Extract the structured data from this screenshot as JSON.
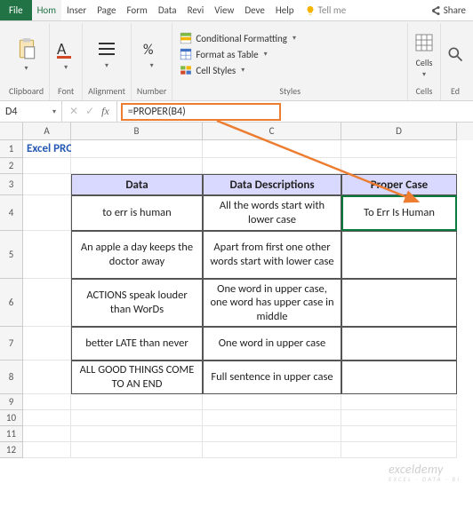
{
  "tabs": {
    "file": "File",
    "home": "Hom",
    "insert": "Inser",
    "page": "Page",
    "formulas": "Form",
    "data": "Data",
    "review": "Revi",
    "view": "View",
    "developer": "Deve",
    "help": "Help",
    "tellme": "Tell me",
    "share": "Share"
  },
  "groups": {
    "clipboard": "Clipboard",
    "font": "Font",
    "alignment": "Alignment",
    "number": "Number",
    "styles": "Styles",
    "cells": "Cells",
    "editing": "Ed"
  },
  "stylesBtns": {
    "cond": "Conditional Formatting",
    "table": "Format as Table",
    "cell": "Cell Styles"
  },
  "cellsBtn": "Cells",
  "namebox": "D4",
  "formula": "=PROPER(B4)",
  "colheads": [
    "A",
    "B",
    "C",
    "D"
  ],
  "rows": [
    "1",
    "2",
    "3",
    "4",
    "5",
    "6",
    "7",
    "8",
    "9",
    "10",
    "11",
    "12"
  ],
  "title": "Excel PROPER Function",
  "headers": {
    "data": "Data",
    "desc": "Data Descriptions",
    "proper": "Proper Case"
  },
  "r4": {
    "b": "to err is human",
    "c": "All the words start with lower case",
    "d": "To Err Is Human"
  },
  "r5": {
    "b": "An apple a day keeps the doctor away",
    "c": "Apart from first one other words start with lower case"
  },
  "r6": {
    "b": "ACTIONS speak louder than WorDs",
    "c": "One word in upper case, one word has upper case in middle"
  },
  "r7": {
    "b": "better LATE than never",
    "c": "One word in upper case"
  },
  "r8": {
    "b": "ALL GOOD THINGS COME TO AN END",
    "c": "Full sentence in upper case"
  },
  "watermark": {
    "main": "exceldemy",
    "sub": "EXCEL · DATA · BI"
  }
}
